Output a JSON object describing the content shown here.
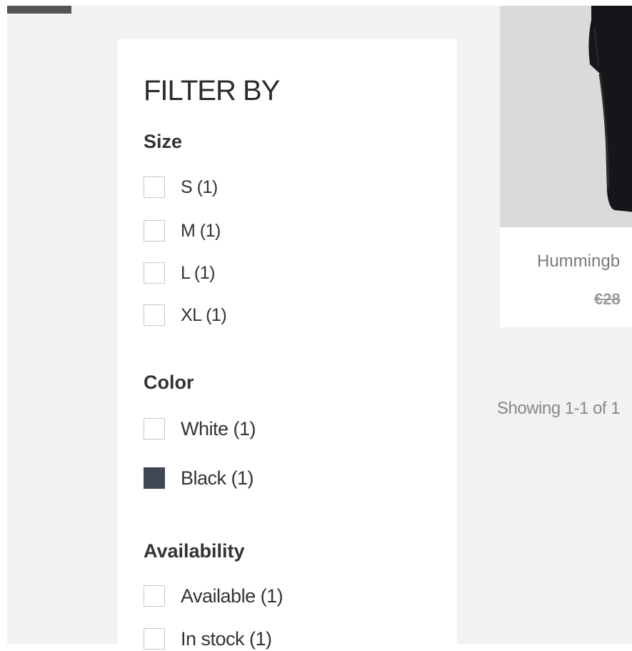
{
  "filter": {
    "title": "FILTER BY",
    "groups": [
      {
        "name": "Size",
        "options": [
          {
            "label": "S (1)",
            "checked": false
          },
          {
            "label": "M (1)",
            "checked": false
          },
          {
            "label": "L (1)",
            "checked": false
          },
          {
            "label": "XL (1)",
            "checked": false
          }
        ]
      },
      {
        "name": "Color",
        "options": [
          {
            "label": "White (1)",
            "swatch": "#ffffff"
          },
          {
            "label": "Black (1)",
            "swatch": "#3f4754"
          }
        ]
      },
      {
        "name": "Availability",
        "options": [
          {
            "label": "Available (1)",
            "checked": false
          },
          {
            "label": "In stock (1)",
            "checked": false
          }
        ]
      }
    ]
  },
  "product": {
    "name": "Hummingb",
    "price": "€28"
  },
  "listing": {
    "showing": "Showing 1-1 of 1"
  },
  "colors": {
    "background": "#f2f2f2",
    "panel": "#ffffff",
    "swatch_black": "#3f4754",
    "product_image_bg": "#dadada"
  }
}
